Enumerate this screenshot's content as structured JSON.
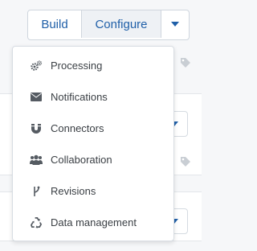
{
  "toolbar": {
    "build_label": "Build",
    "configure_label": "Configure"
  },
  "menu": {
    "items": [
      {
        "label": "Processing",
        "icon": "gears-icon"
      },
      {
        "label": "Notifications",
        "icon": "envelope-icon"
      },
      {
        "label": "Connectors",
        "icon": "magnet-icon"
      },
      {
        "label": "Collaboration",
        "icon": "users-icon"
      },
      {
        "label": "Revisions",
        "icon": "branch-icon"
      },
      {
        "label": "Data management",
        "icon": "recycle-icon"
      }
    ]
  },
  "colors": {
    "accent": "#1f5fa8",
    "icon": "#555b62",
    "menu_text": "#3a3f44"
  }
}
